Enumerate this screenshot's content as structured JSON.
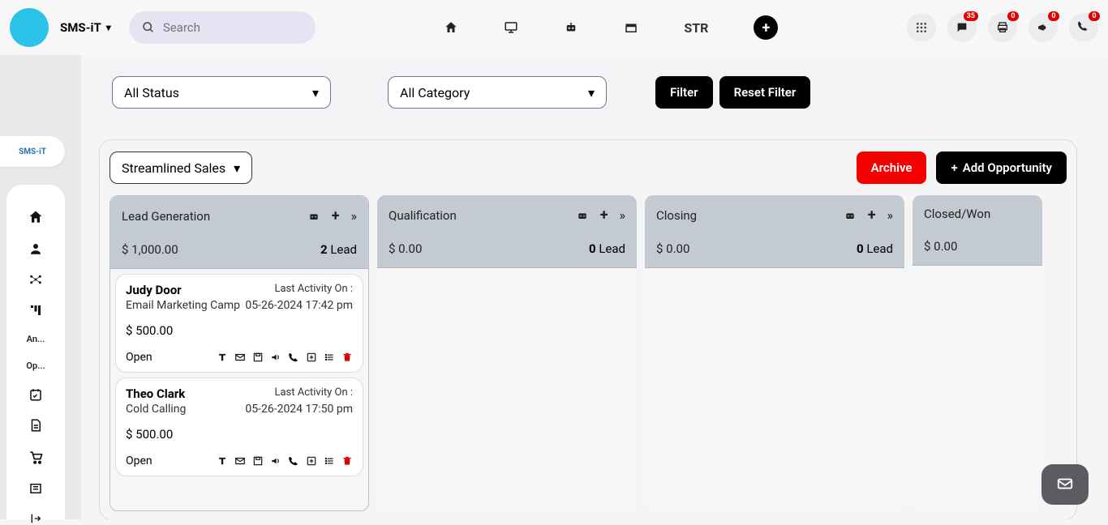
{
  "brand": {
    "name": "SMS-iT"
  },
  "search": {
    "placeholder": "Search"
  },
  "topCenter": {
    "str": "STR"
  },
  "topRight": {
    "badges": {
      "chat": "35",
      "print": "0",
      "announce": "0",
      "phone": "0"
    }
  },
  "smsBadge": "SMS-iT",
  "sidebar": {
    "items": [
      "An...",
      "Op..."
    ]
  },
  "filters": {
    "status": "All Status",
    "category": "All Category",
    "filter": "Filter",
    "reset": "Reset Filter"
  },
  "board": {
    "pipeline": "Streamlined Sales",
    "archive": "Archive",
    "add": "Add Opportunity",
    "columns": [
      {
        "title": "Lead Generation",
        "amount": "$ 1,000.00",
        "count": "2",
        "countLabel": "Lead"
      },
      {
        "title": "Qualification",
        "amount": "$ 0.00",
        "count": "0",
        "countLabel": "Lead"
      },
      {
        "title": "Closing",
        "amount": "$ 0.00",
        "count": "0",
        "countLabel": "Lead"
      },
      {
        "title": "Closed/Won",
        "amount": "$ 0.00",
        "count": "",
        "countLabel": ""
      }
    ],
    "cards": [
      {
        "name": "Judy Door",
        "sub": "Email Marketing Camp",
        "activityLabel": "Last Activity On :",
        "date": "05-26-2024 17:42 pm",
        "price": "$ 500.00",
        "status": "Open"
      },
      {
        "name": "Theo Clark",
        "sub": "Cold Calling",
        "activityLabel": "Last Activity On :",
        "date": "05-26-2024 17:50 pm",
        "price": "$ 500.00",
        "status": "Open"
      }
    ]
  }
}
